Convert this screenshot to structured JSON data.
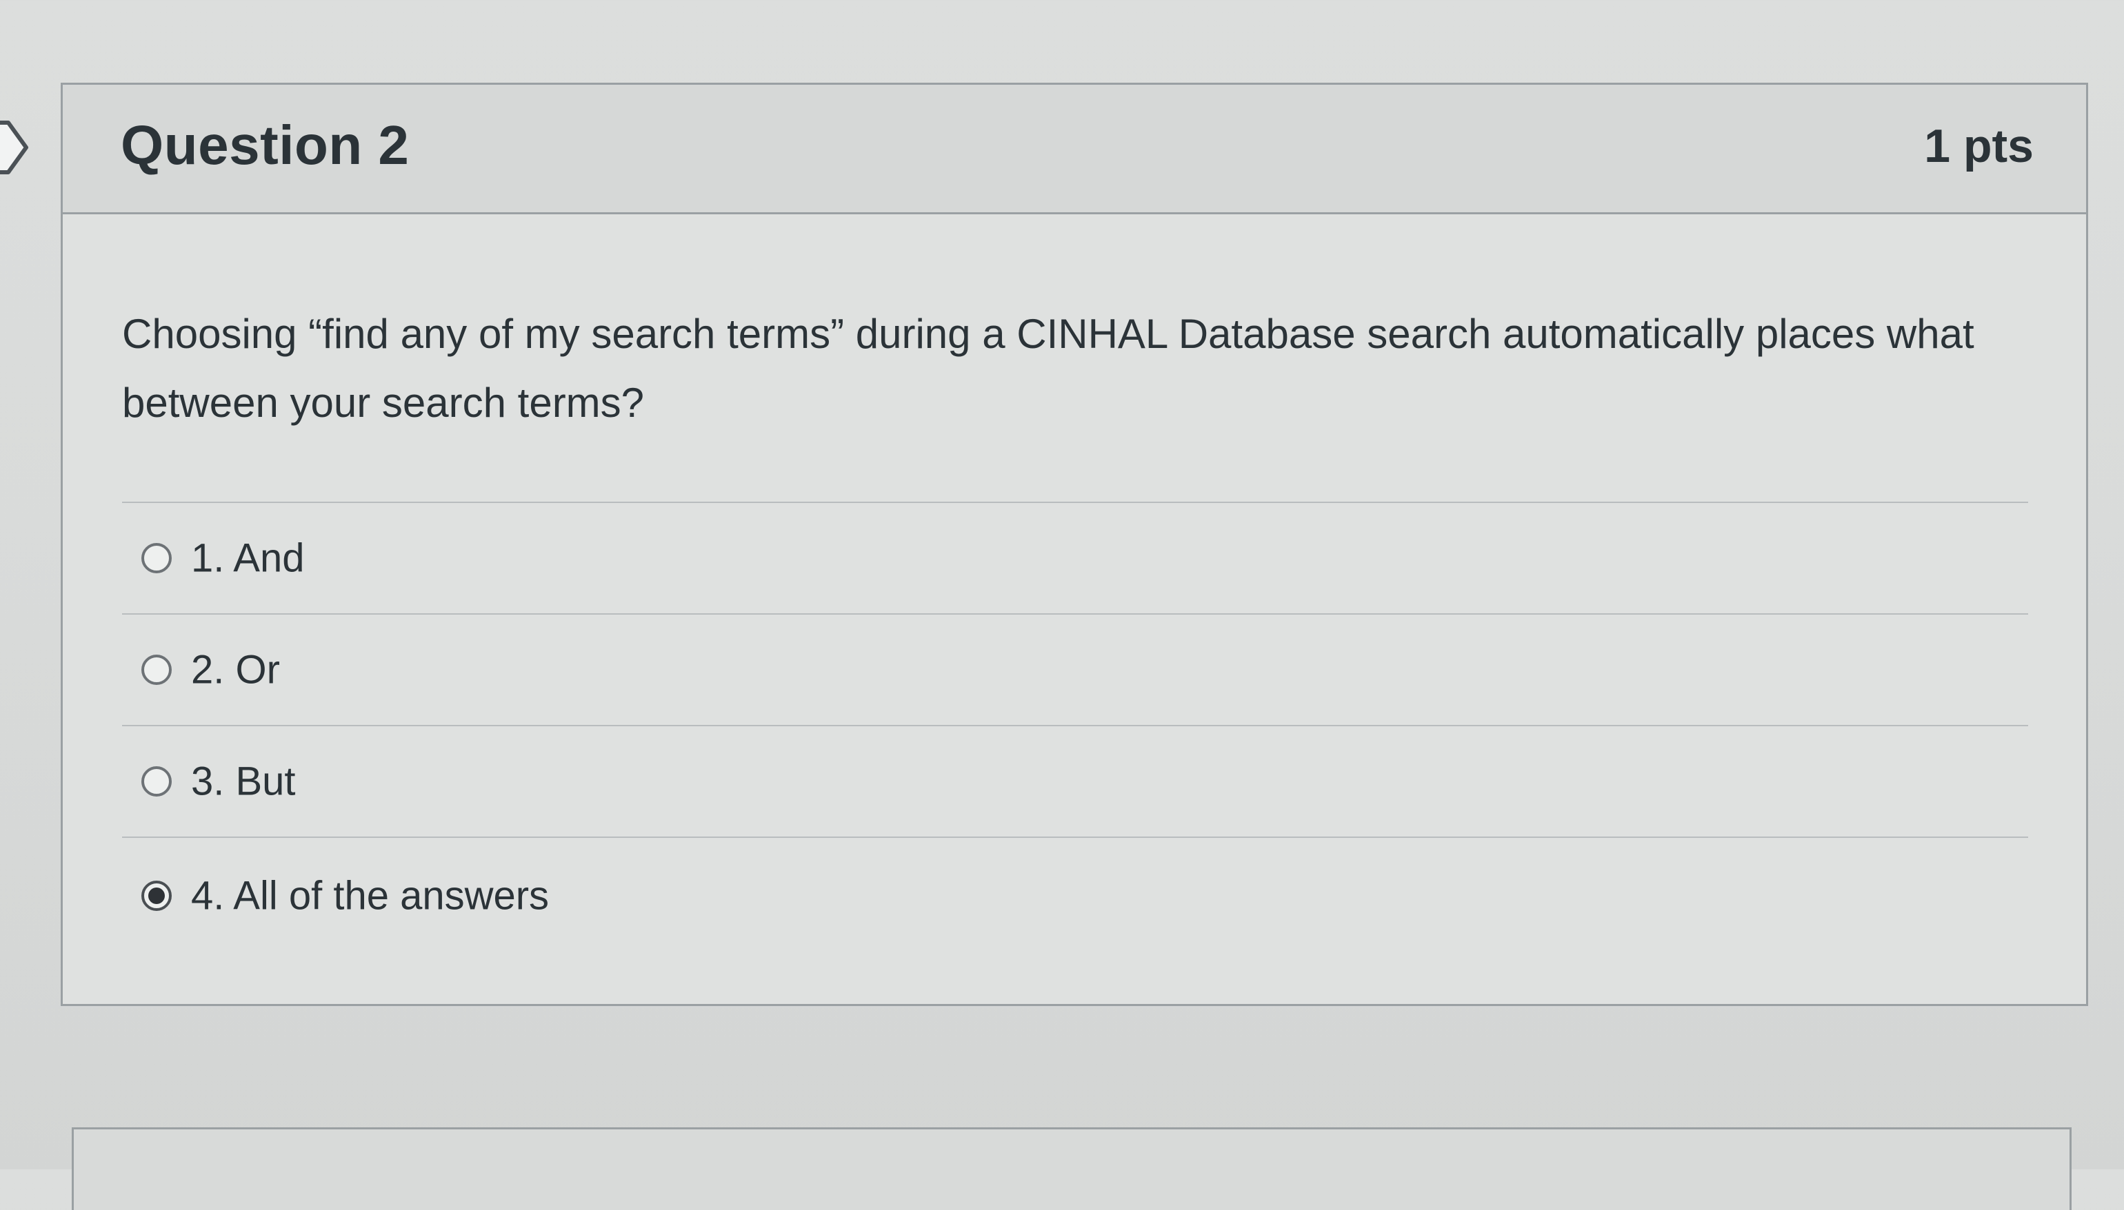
{
  "question": {
    "title": "Question 2",
    "points": "1 pts",
    "text": "Choosing “find any of my search terms” during a CINHAL Database search automatically places what between your search terms?"
  },
  "answers": [
    {
      "label": "1. And",
      "selected": false
    },
    {
      "label": "2. Or",
      "selected": false
    },
    {
      "label": "3. But",
      "selected": false
    },
    {
      "label": "4. All of the answers",
      "selected": true
    }
  ],
  "icons": {
    "flag": "flag-marker-icon"
  },
  "colors": {
    "background": "#dcdedd",
    "card_border": "#9aa0a3",
    "text": "#2b3338"
  }
}
